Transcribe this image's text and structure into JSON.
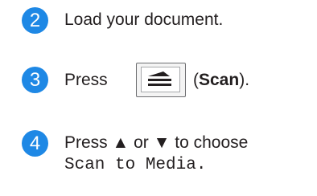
{
  "steps": [
    {
      "number": "2",
      "text": "Load your document."
    },
    {
      "number": "3",
      "prefix": "Press",
      "button_icon": "scan-icon",
      "paren_open": "(",
      "bold": "Scan",
      "paren_close": ")."
    },
    {
      "number": "4",
      "line1": "Press ▲ or ▼ to choose",
      "line2": "Scan to Media."
    }
  ],
  "colors": {
    "badge": "#1e88e5",
    "text": "#231f20"
  }
}
